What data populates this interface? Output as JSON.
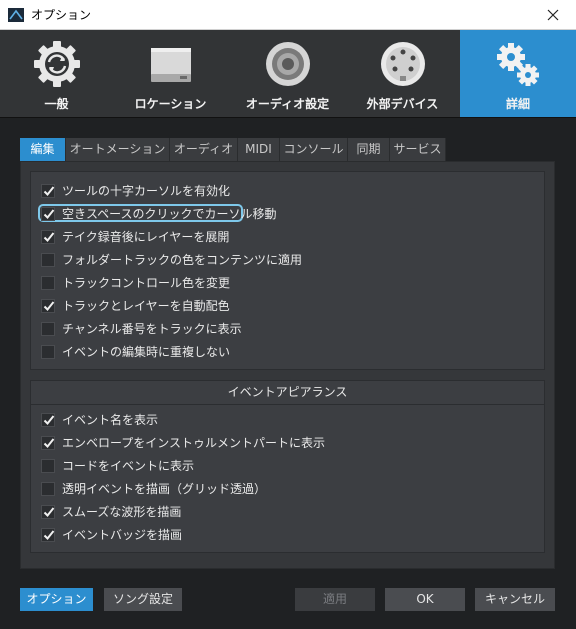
{
  "window": {
    "title": "オプション",
    "icon": "studio-one-icon",
    "close_icon": "close-icon"
  },
  "categories": [
    {
      "label": "一般",
      "icon": "sync-gear-icon",
      "active": false
    },
    {
      "label": "ロケーション",
      "icon": "drive-icon",
      "active": false
    },
    {
      "label": "オーディオ設定",
      "icon": "speaker-icon",
      "active": false
    },
    {
      "label": "外部デバイス",
      "icon": "midi-plug-icon",
      "active": false
    },
    {
      "label": "詳細",
      "icon": "gears-icon",
      "active": true
    }
  ],
  "tabs": [
    {
      "label": "編集",
      "active": true
    },
    {
      "label": "オートメーション",
      "active": false
    },
    {
      "label": "オーディオ",
      "active": false
    },
    {
      "label": "MIDI",
      "active": false
    },
    {
      "label": "コンソール",
      "active": false
    },
    {
      "label": "同期",
      "active": false
    },
    {
      "label": "サービス",
      "active": false
    }
  ],
  "edit_options": [
    {
      "label": "ツールの十字カーソルを有効化",
      "checked": true
    },
    {
      "label": "空きスペースのクリックでカーソル移動",
      "checked": true
    },
    {
      "label": "テイク録音後にレイヤーを展開",
      "checked": true
    },
    {
      "label": "フォルダートラックの色をコンテンツに適用",
      "checked": false
    },
    {
      "label": "トラックコントロール色を変更",
      "checked": false
    },
    {
      "label": "トラックとレイヤーを自動配色",
      "checked": true
    },
    {
      "label": "チャンネル番号をトラックに表示",
      "checked": false
    },
    {
      "label": "イベントの編集時に重複しない",
      "checked": false
    }
  ],
  "event_appearance": {
    "title": "イベントアピアランス",
    "options": [
      {
        "label": "イベント名を表示",
        "checked": true
      },
      {
        "label": "エンベロープをインストゥルメントパートに表示",
        "checked": true
      },
      {
        "label": "コードをイベントに表示",
        "checked": false
      },
      {
        "label": "透明イベントを描画（グリッド透過）",
        "checked": false
      },
      {
        "label": "スムーズな波形を描画",
        "checked": true
      },
      {
        "label": "イベントバッジを描画",
        "checked": true
      }
    ]
  },
  "footer": {
    "options_label": "オプション",
    "song_settings_label": "ソング設定",
    "apply_label": "適用",
    "ok_label": "OK",
    "cancel_label": "キャンセル"
  },
  "colors": {
    "accent": "#2c8ecf",
    "highlight_outline": "#7ec8ea",
    "background": "#1f2123",
    "panel": "#35373a"
  }
}
